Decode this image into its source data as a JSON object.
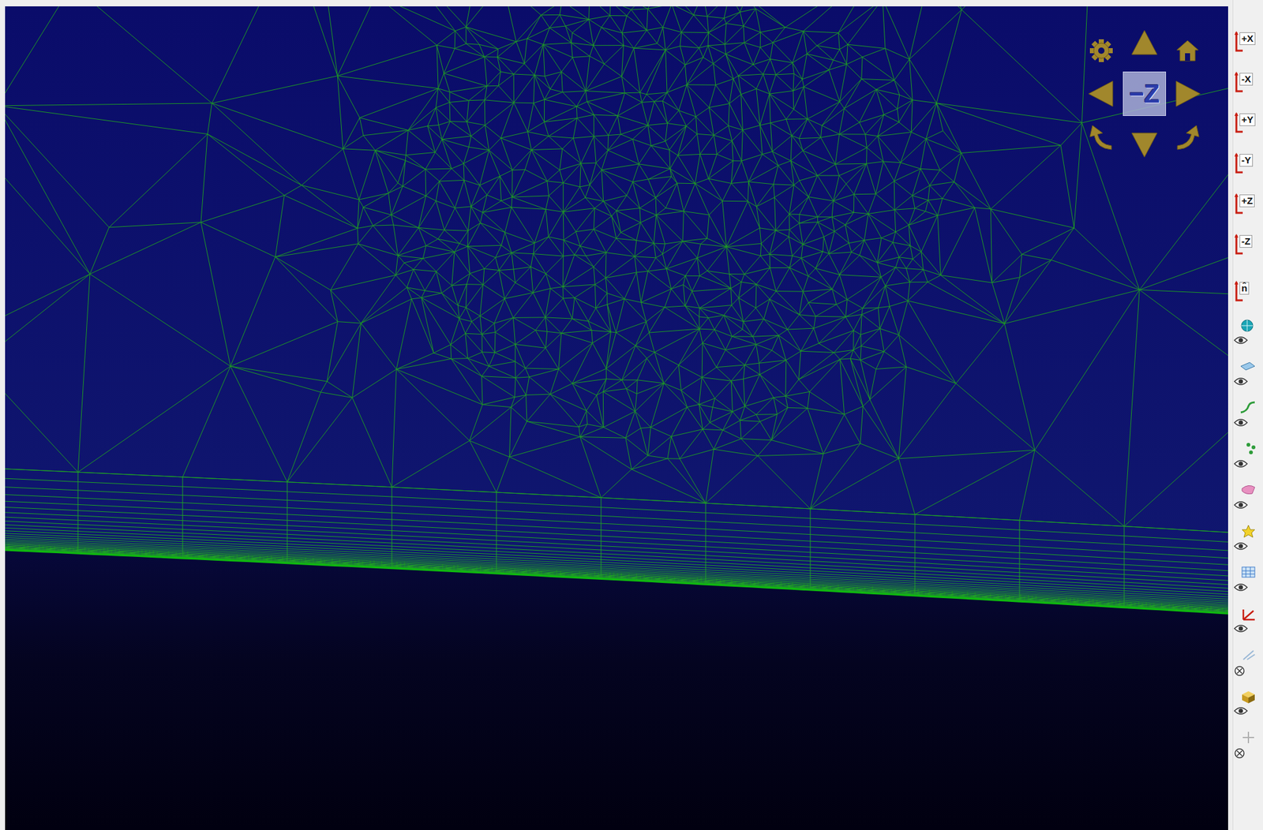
{
  "viewport": {
    "nav_cube": {
      "face_label": "−Z"
    }
  },
  "view_buttons": [
    {
      "label": "+X"
    },
    {
      "label": "-X"
    },
    {
      "label": "+Y"
    },
    {
      "label": "-Y"
    },
    {
      "label": "+Z"
    },
    {
      "label": "-Z"
    },
    {
      "label": "n̂"
    }
  ],
  "display_toggles": [
    {
      "kind": "globe",
      "visible": true
    },
    {
      "kind": "plane",
      "visible": true
    },
    {
      "kind": "curve",
      "visible": true
    },
    {
      "kind": "points",
      "visible": true
    },
    {
      "kind": "shape",
      "visible": true
    },
    {
      "kind": "light",
      "visible": true
    },
    {
      "kind": "grid",
      "visible": true
    },
    {
      "kind": "axes",
      "visible": true
    },
    {
      "kind": "vectors",
      "visible": false
    },
    {
      "kind": "cube",
      "visible": true
    },
    {
      "kind": "crosshair",
      "visible": false
    }
  ]
}
